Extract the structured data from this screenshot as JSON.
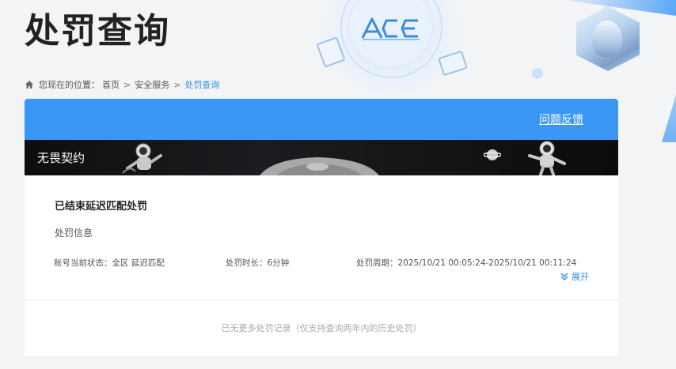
{
  "header": {
    "title": "处罚查询",
    "logo_text": "ACE"
  },
  "breadcrumb": {
    "prefix": "您现在的位置：",
    "items": [
      "首页",
      "安全服务"
    ],
    "current": "处罚查询",
    "separator": ">"
  },
  "panel": {
    "feedback_label": "问题反馈",
    "game_name": "无畏契约",
    "record": {
      "title": "已结束延迟匹配处罚",
      "section_label": "处罚信息",
      "status": "账号当前状态：全区 延迟匹配",
      "duration": "处罚时长：6分钟",
      "period": "处罚周期：2025/10/21 00:05:24-2025/10/21 00:11:24",
      "expand_label": "展开"
    },
    "no_more_text": "已无更多处罚记录（仅支持查询两年内的历史处罚）"
  },
  "colors": {
    "accent": "#3b97f6",
    "link": "#2f8de8",
    "banner_bg": "#111113"
  },
  "icons": [
    "home-icon",
    "chevron-down-icon",
    "ace-logo",
    "avatar"
  ]
}
